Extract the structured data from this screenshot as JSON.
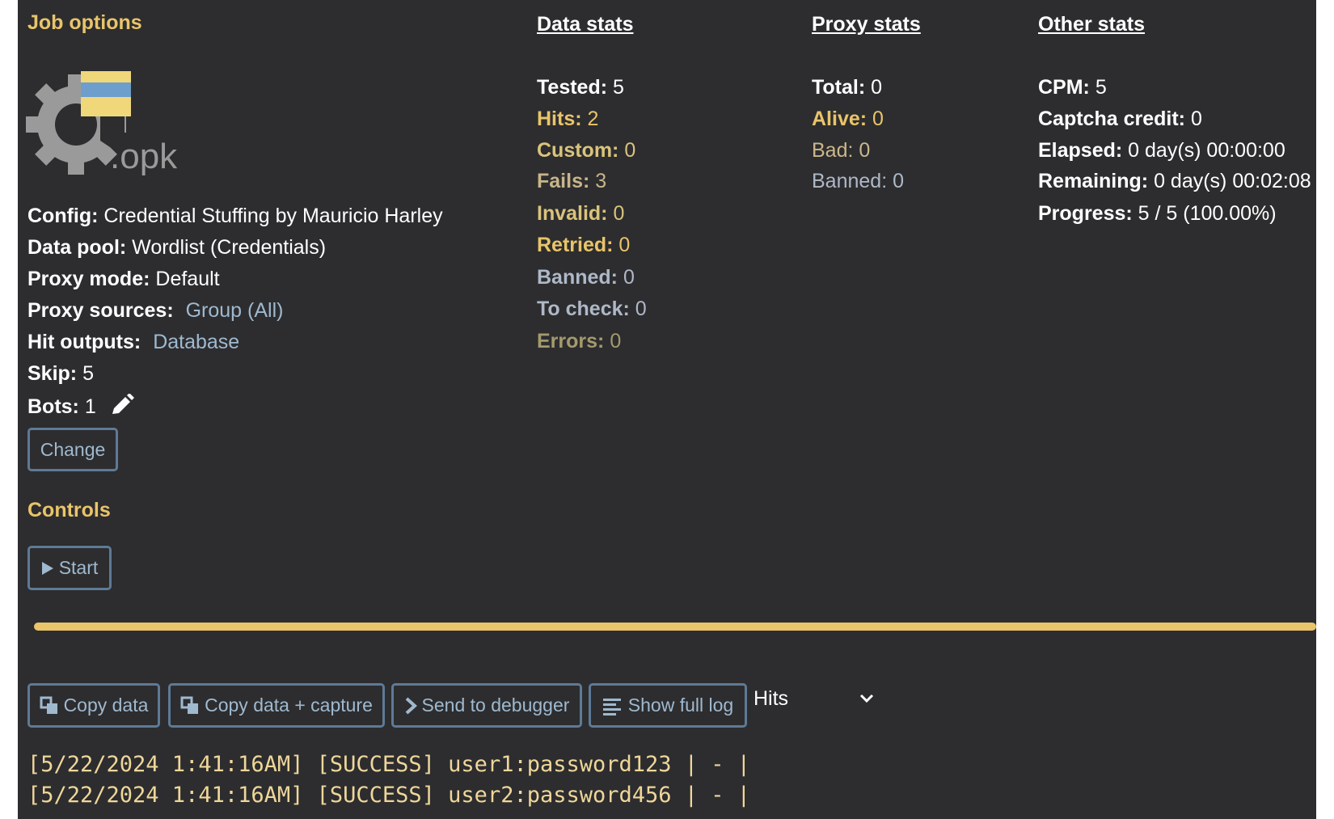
{
  "job_options": {
    "title": "Job options",
    "logo_text": ".opk",
    "config_label": "Config:",
    "config_value": "Credential Stuffing by Mauricio Harley",
    "data_pool_label": "Data pool:",
    "data_pool_value": "Wordlist (Credentials)",
    "proxy_mode_label": "Proxy mode:",
    "proxy_mode_value": "Default",
    "proxy_sources_label": "Proxy sources:",
    "proxy_sources_value": "Group (All)",
    "hit_outputs_label": "Hit outputs:",
    "hit_outputs_value": "Database",
    "skip_label": "Skip:",
    "skip_value": "5",
    "bots_label": "Bots:",
    "bots_value": "1",
    "change_label": "Change"
  },
  "controls": {
    "title": "Controls",
    "start_label": "Start"
  },
  "data_stats": {
    "title": "Data stats",
    "items": [
      {
        "label": "Tested:",
        "value": "5"
      },
      {
        "label": "Hits:",
        "value": "2"
      },
      {
        "label": "Custom:",
        "value": "0"
      },
      {
        "label": "Fails:",
        "value": "3"
      },
      {
        "label": "Invalid:",
        "value": "0"
      },
      {
        "label": "Retried:",
        "value": "0"
      },
      {
        "label": "Banned:",
        "value": "0"
      },
      {
        "label": "To check:",
        "value": "0"
      },
      {
        "label": "Errors:",
        "value": "0"
      }
    ]
  },
  "proxy_stats": {
    "title": "Proxy stats",
    "items": [
      {
        "label": "Total:",
        "value": "0"
      },
      {
        "label": "Alive:",
        "value": "0"
      },
      {
        "label": "Bad:",
        "value": "0"
      },
      {
        "label": "Banned:",
        "value": "0"
      }
    ]
  },
  "other_stats": {
    "title": "Other stats",
    "items": [
      {
        "label": "CPM:",
        "value": "5"
      },
      {
        "label": "Captcha credit:",
        "value": "0"
      },
      {
        "label": "Elapsed:",
        "value": "0 day(s) 00:00:00"
      },
      {
        "label": "Remaining:",
        "value": "0 day(s) 00:02:08"
      },
      {
        "label": "Progress:",
        "value": "5 / 5 (100.00%)"
      }
    ]
  },
  "progress": {
    "fraction": 1.0,
    "color": "#e9c46a"
  },
  "toolbar": {
    "copy_data": "Copy data",
    "copy_data_capture": "Copy data + capture",
    "send_to_debugger": "Send to debugger",
    "show_full_log": "Show full log",
    "filter_selected": "Hits"
  },
  "log_lines": [
    "[5/22/2024 1:41:16AM] [SUCCESS] user1:password123 | - |",
    "[5/22/2024 1:41:16AM] [SUCCESS] user2:password456 | - |"
  ],
  "colors": {
    "background": "#2d2d2f",
    "accent_yellow": "#e9c46a",
    "link_blue": "#9fb9cf",
    "button_border": "#5e7a96"
  },
  "icons": {
    "logo": "gear-logo-icon",
    "edit": "pencil-icon",
    "play": "play-icon",
    "copy": "copy-icon",
    "send": "chevron-right-icon",
    "log": "list-lines-icon",
    "dropdown": "chevron-down-icon"
  }
}
